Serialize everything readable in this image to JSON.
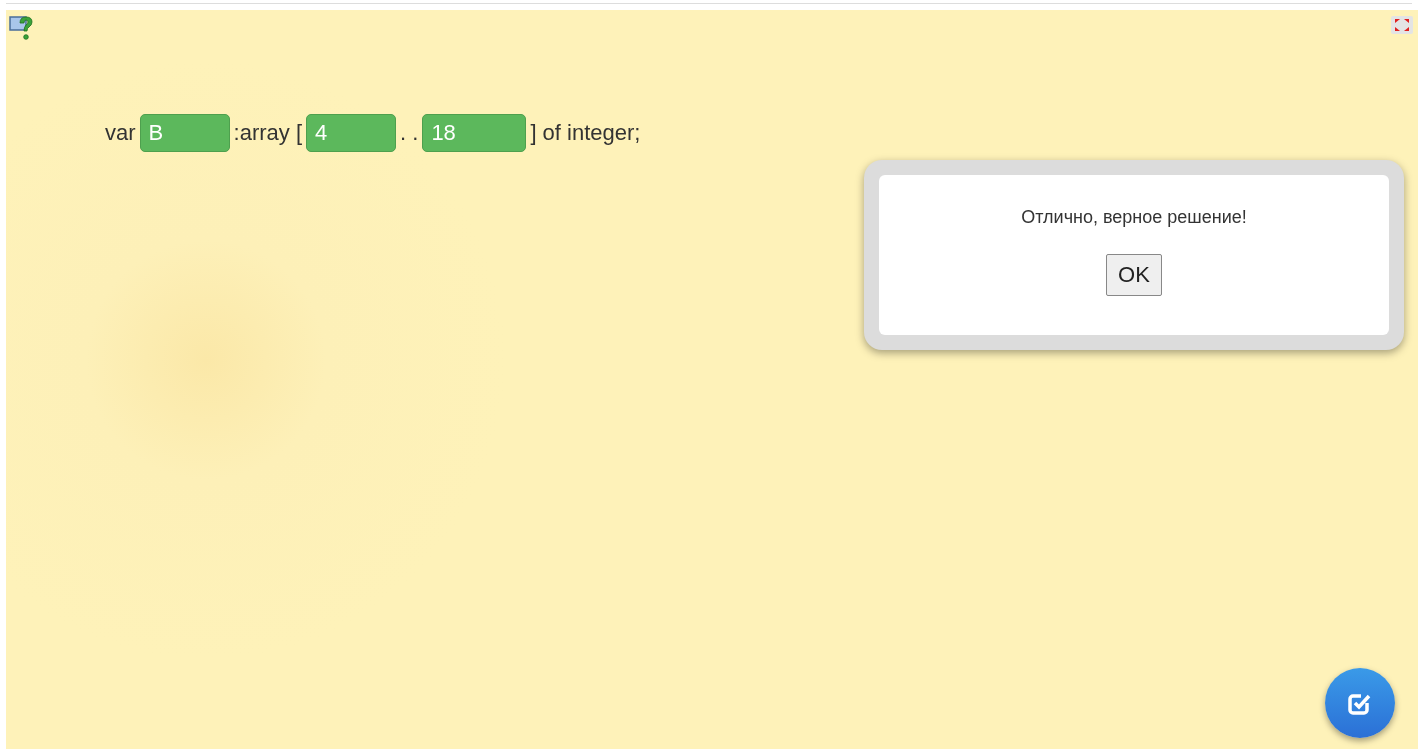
{
  "statement": {
    "parts": [
      {
        "kind": "text",
        "text": "var"
      },
      {
        "kind": "field",
        "value": "B",
        "correct": true
      },
      {
        "kind": "text",
        "text": ":array ["
      },
      {
        "kind": "field",
        "value": "4",
        "correct": true
      },
      {
        "kind": "text",
        "text": ". ."
      },
      {
        "kind": "field",
        "value": "18",
        "correct": true
      },
      {
        "kind": "text",
        "text": "] of integer;"
      }
    ]
  },
  "dialog": {
    "message": "Отлично, верное решение!",
    "button": "OK"
  }
}
